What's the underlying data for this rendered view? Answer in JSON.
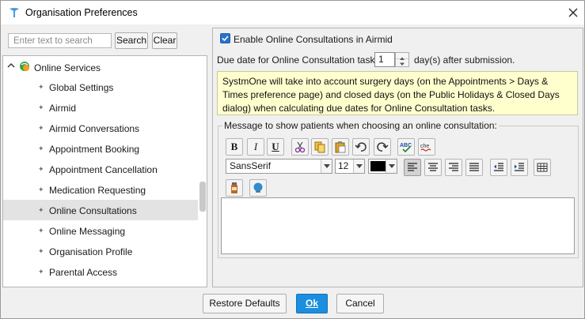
{
  "window": {
    "title": "Organisation Preferences"
  },
  "search": {
    "placeholder": "Enter text to search",
    "value": "",
    "search_label": "Search",
    "clear_label": "Clear"
  },
  "tree": {
    "root_label": "Online Services",
    "items": [
      {
        "label": "Global Settings",
        "selected": false
      },
      {
        "label": "Airmid",
        "selected": false
      },
      {
        "label": "Airmid Conversations",
        "selected": false
      },
      {
        "label": "Appointment Booking",
        "selected": false
      },
      {
        "label": "Appointment Cancellation",
        "selected": false
      },
      {
        "label": "Medication Requesting",
        "selected": false
      },
      {
        "label": "Online Consultations",
        "selected": true
      },
      {
        "label": "Online Messaging",
        "selected": false
      },
      {
        "label": "Organisation Profile",
        "selected": false
      },
      {
        "label": "Parental Access",
        "selected": false
      }
    ]
  },
  "settings": {
    "enable_label": "Enable Online Consultations in Airmid",
    "enable_checked": true,
    "due_label": "Due date for Online Consultation tasks is",
    "due_value": "1",
    "due_suffix": "day(s) after submission.",
    "info_text": "SystmOne will take into account surgery days (on the Appointments > Days & Times preference page) and closed days (on the Public Holidays & Closed Days dialog) when calculating due dates for Online Consultation tasks.",
    "message_legend": "Message to show patients when choosing an online consultation:"
  },
  "editor": {
    "font_value": "SansSerif",
    "size_value": "12",
    "text_color": "#000000",
    "content": ""
  },
  "footer": {
    "restore_label": "Restore Defaults",
    "ok_label": "Ok",
    "cancel_label": "Cancel"
  },
  "colors": {
    "accent": "#1c8ee0",
    "info_bg": "#ffffce",
    "selected_row": "#e3e3e3"
  }
}
